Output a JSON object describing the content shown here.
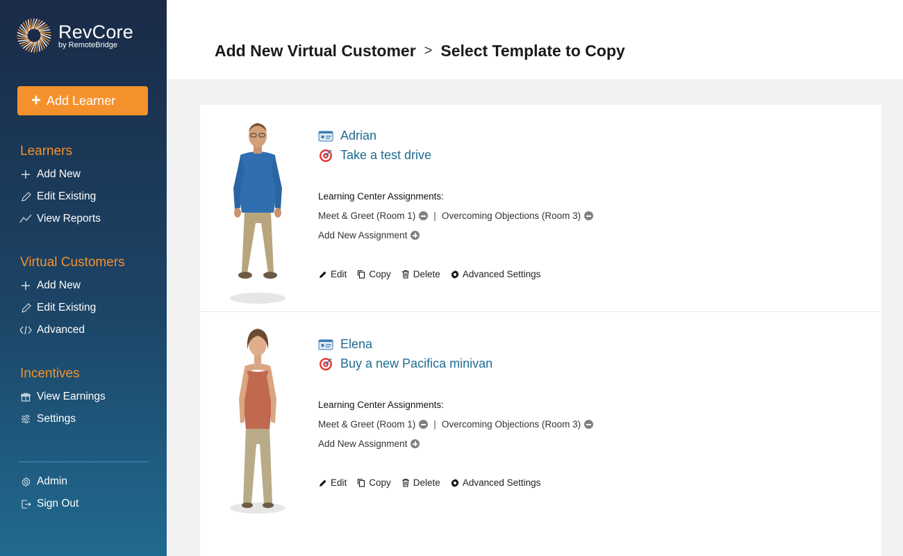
{
  "brand": {
    "name": "RevCore",
    "byline": "by RemoteBridge"
  },
  "sidebar": {
    "add_learner_label": "Add Learner",
    "sections": [
      {
        "title": "Learners",
        "items": [
          {
            "label": "Add New",
            "icon": "plus-icon"
          },
          {
            "label": "Edit Existing",
            "icon": "pencil-icon"
          },
          {
            "label": "View Reports",
            "icon": "trend-line-icon"
          }
        ]
      },
      {
        "title": "Virtual Customers",
        "items": [
          {
            "label": "Add New",
            "icon": "plus-icon"
          },
          {
            "label": "Edit Existing",
            "icon": "pencil-icon"
          },
          {
            "label": "Advanced",
            "icon": "code-icon"
          }
        ]
      },
      {
        "title": "Incentives",
        "items": [
          {
            "label": "View Earnings",
            "icon": "gift-icon"
          },
          {
            "label": "Settings",
            "icon": "sliders-icon"
          }
        ]
      }
    ],
    "footer_items": [
      {
        "label": "Admin",
        "icon": "gear-icon"
      },
      {
        "label": "Sign Out",
        "icon": "sign-out-icon"
      }
    ]
  },
  "breadcrumb": {
    "parent": "Add New Virtual Customer",
    "separator": ">",
    "current": "Select Template to Copy"
  },
  "customers": [
    {
      "name": "Adrian",
      "goal": "Take a test drive",
      "assignments_title": "Learning Center Assignments:",
      "assignments": [
        "Meet & Greet (Room 1)",
        "Overcoming Objections (Room 3)"
      ],
      "add_assignment_label": "Add New Assignment",
      "actions": {
        "edit": "Edit",
        "copy": "Copy",
        "delete": "Delete",
        "advanced": "Advanced Settings"
      }
    },
    {
      "name": "Elena",
      "goal": "Buy a new Pacifica minivan",
      "assignments_title": "Learning Center Assignments:",
      "assignments": [
        "Meet & Greet (Room 1)",
        "Overcoming Objections (Room 3)"
      ],
      "add_assignment_label": "Add New Assignment",
      "actions": {
        "edit": "Edit",
        "copy": "Copy",
        "delete": "Delete",
        "advanced": "Advanced Settings"
      }
    }
  ],
  "colors": {
    "accent": "#f5912c",
    "link": "#1f6b91",
    "sidebar_top": "#1a2b47",
    "sidebar_bottom": "#216a8f"
  }
}
